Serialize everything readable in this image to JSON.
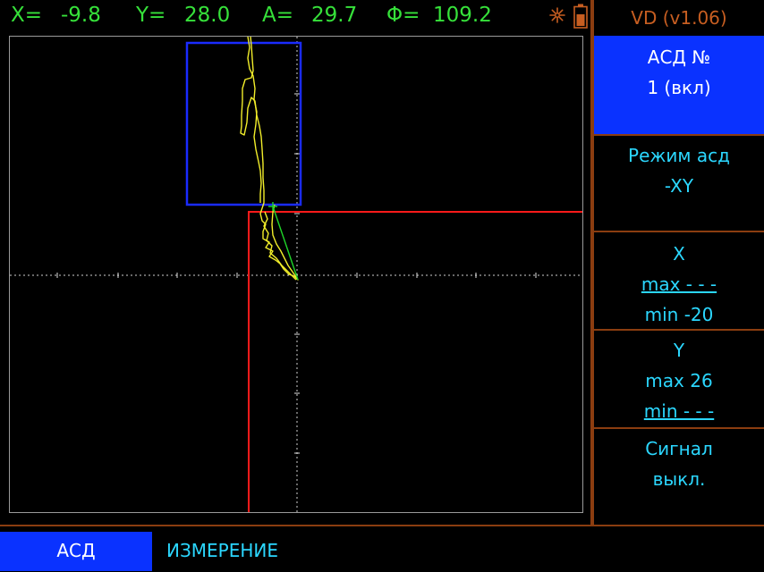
{
  "readout": {
    "x_label": "X=",
    "x_value": "-9.8",
    "y_label": "Y=",
    "y_value": "28.0",
    "a_label": "A=",
    "a_value": "29.7",
    "phi_label": "Φ=",
    "phi_value": "109.2",
    "color": "#36e13a"
  },
  "status_icons": [
    "sun-icon",
    "battery-icon"
  ],
  "version": "VD (v1.06)",
  "panel": {
    "asd": {
      "line1": "АСД №",
      "line2": "1 (вкл)"
    },
    "mode": {
      "line1": "Режим асд",
      "line2": "-XY"
    },
    "x": {
      "title": "X",
      "max": "max - - -",
      "min": "min -20"
    },
    "y": {
      "title": "Y",
      "max": "max 26",
      "min": "min - - -"
    },
    "signal": {
      "line1": "Сигнал",
      "line2": "выкл."
    }
  },
  "tabs": {
    "asd": "АСД",
    "measure": "ИЗМЕРЕНИЕ"
  },
  "colors": {
    "accent_blue": "#0a32ff",
    "label_cyan": "#2bd7ff",
    "frame_orange": "#8b3d10",
    "version_orange": "#c75e21",
    "trace_yellow": "#f2ee2a",
    "gate_red": "#ff1a1a",
    "gate_blue": "#1a2bff",
    "vector_green": "#1fd629"
  }
}
